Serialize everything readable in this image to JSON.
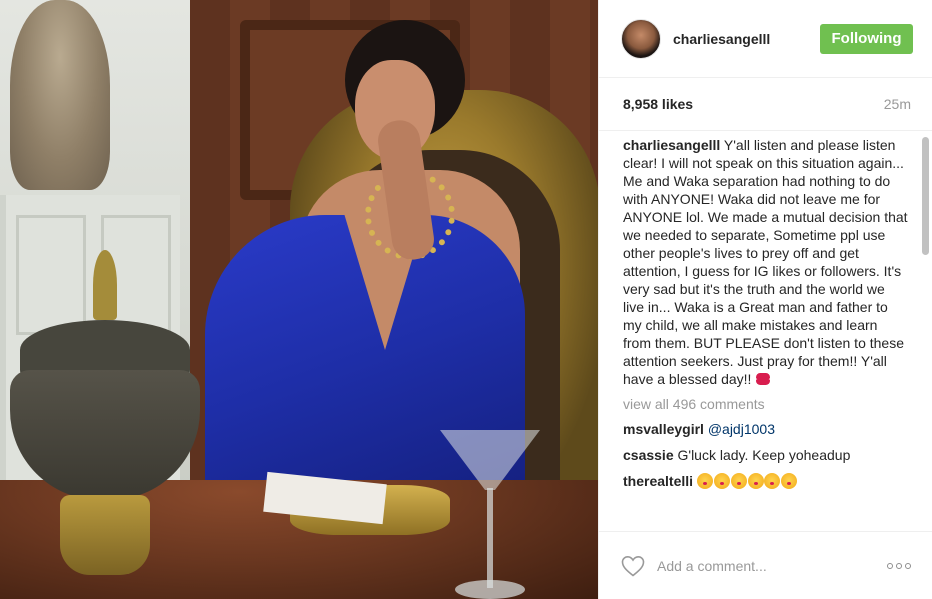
{
  "post": {
    "username": "charliesangelll",
    "follow_label": "Following",
    "likes": "8,958 likes",
    "time": "25m",
    "caption": {
      "user": "charliesangelll",
      "text": " Y'all listen and please listen clear! I will not speak on this situation again... Me and Waka separation had nothing to do with ANYONE! Waka did not leave me for ANYONE lol. We made a mutual decision that we needed to separate, Sometime ppl use other people's lives to prey off and get attention, I guess for IG likes or followers. It's very sad but it's the truth and the world we live in... Waka is a Great man and father to my child, we all make mistakes and learn from them. BUT PLEASE don't listen to these attention seekers. Just pray for them!! Y'all have a blessed day!!",
      "emoji_icon": "kiss-mark-icon"
    },
    "view_all_comments": "view all 496 comments",
    "comments": [
      {
        "user": "msvalleygirl",
        "mention": "@ajdj1003",
        "text": ""
      },
      {
        "user": "csassie",
        "mention": "",
        "text": "G'luck lady. Keep yoheadup"
      },
      {
        "user": "therealtelli",
        "mention": "",
        "text": "",
        "emoji_icon": "kissing-face-icon",
        "emoji_count": 6
      }
    ],
    "add_comment_placeholder": "Add a comment...",
    "colors": {
      "follow_button": "#70c050",
      "mention": "#003569",
      "muted_text": "#999999"
    }
  }
}
